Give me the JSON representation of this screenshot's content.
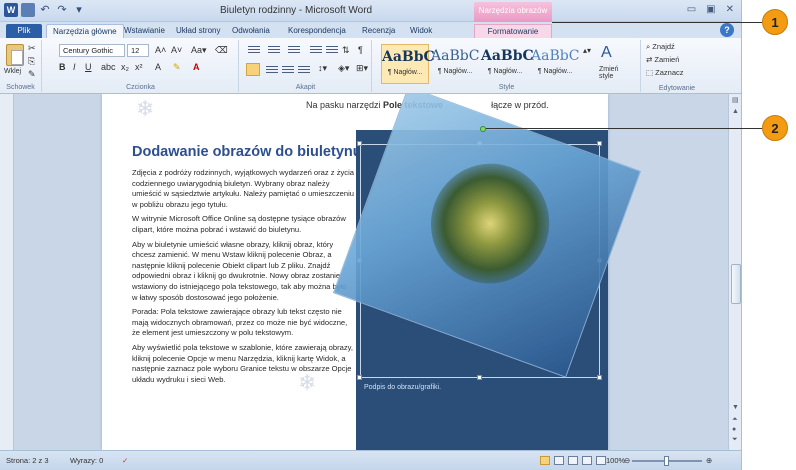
{
  "window": {
    "title": "Biuletyn rodzinny - Microsoft Word",
    "context_tab_group": "Narzędzia obrazów",
    "controls": [
      "▭",
      "▣",
      "✕"
    ]
  },
  "tabs": {
    "file": "Plik",
    "items": [
      "Narzędzia główne",
      "Wstawianie",
      "Układ strony",
      "Odwołania",
      "Korespondencja",
      "Recenzja",
      "Widok"
    ],
    "format": "Formatowanie"
  },
  "ribbon": {
    "clipboard": {
      "paste": "Wklej",
      "label": "Schowek"
    },
    "font": {
      "family": "Century Gothic",
      "size": "12",
      "label": "Czcionka"
    },
    "paragraph": {
      "label": "Akapit"
    },
    "styles": {
      "label": "Style",
      "items": [
        {
          "sample": "AaBbC",
          "name": "¶ Nagłów..."
        },
        {
          "sample": "AaBbC",
          "name": "¶ Nagłów..."
        },
        {
          "sample": "AaBbC",
          "name": "¶ Nagłów..."
        },
        {
          "sample": "AaBbC",
          "name": "¶ Nagłów..."
        }
      ],
      "change": "Zmień style"
    },
    "editing": {
      "find": "Znajdź",
      "replace": "Zamień",
      "select": "Zaznacz",
      "label": "Edytowanie"
    }
  },
  "document": {
    "top_line_prefix": "Na pasku narzędzi ",
    "top_line_bold": "Pole tekstowe",
    "top_line_suffix": "łącze w przód.",
    "heading": "Dodawanie obrazów do biuletynu",
    "paragraphs": [
      "Zdjęcia z podróży rodzinnych, wyjątkowych wydarzeń oraz z życia codziennego uwiarygodnią biuletyn. Wybrany obraz należy umieścić w sąsiedztwie artykułu. Należy pamiętać o umieszczeniu w pobliżu obrazu jego tytułu.",
      "W witrynie Microsoft Office Online są dostępne tysiące obrazów clipart, które można pobrać i wstawić do biuletynu.",
      "Aby w biuletynie umieścić własne obrazy, kliknij obraz, który chcesz zamienić. W menu Wstaw kliknij polecenie Obraz, a następnie kliknij polecenie Obiekt clipart lub Z pliku. Znajdź odpowiedni obraz i kliknij go dwukrotnie. Nowy obraz zostanie wstawiony do istniejącego pola tekstowego, tak aby można było w łatwy sposób dostosować jego położenie.",
      "Porada: Pola tekstowe zawierające obrazy lub tekst często nie mają widocznych obramowań, przez co może nie być widoczne, że element jest umieszczony w polu tekstowym.",
      "Aby wyświetlić pola tekstowe w szablonie, które zawierają obrazy, kliknij polecenie Opcje w menu Narzędzia, kliknij kartę Widok, a następnie zaznacz pole wyboru Granice tekstu w obszarze Opcje układu wydruku i sieci Web."
    ],
    "caption": "Podpis do obrazu/grafiki."
  },
  "statusbar": {
    "page": "Strona: 2 z 3",
    "words": "Wyrazy: 0",
    "zoom": "100%"
  },
  "callouts": [
    "1",
    "2"
  ],
  "colors": {
    "accent": "#2b579a",
    "context_tab": "#ea98c3",
    "heading": "#2e4f8f",
    "panel": "#2a4e78",
    "callout": "#f39c12"
  }
}
